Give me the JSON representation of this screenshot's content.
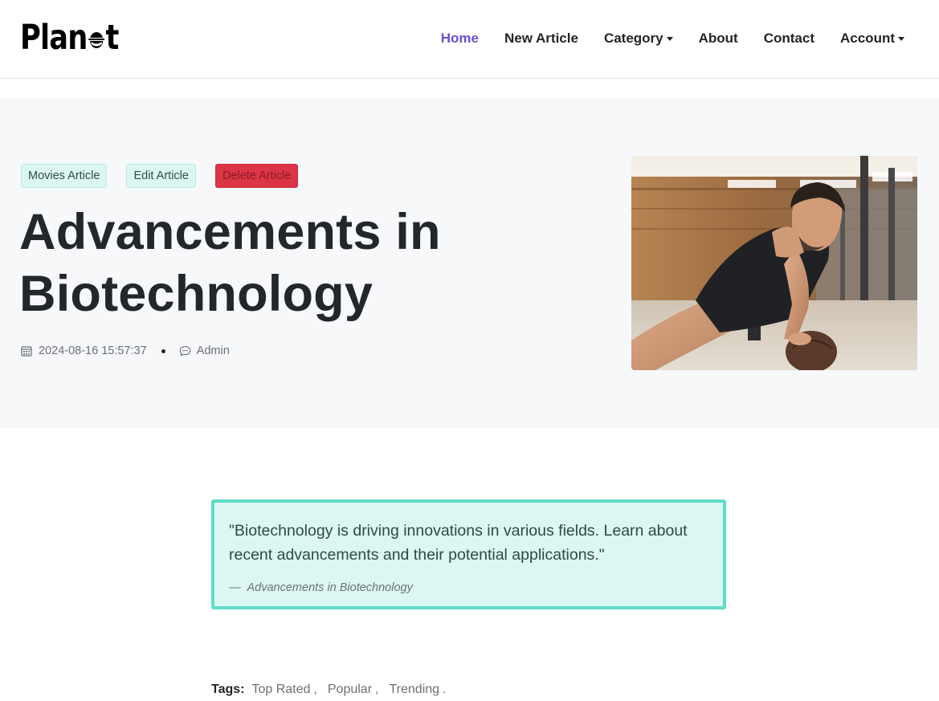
{
  "brand": {
    "text_before": "Plan",
    "text_after": "t"
  },
  "nav": {
    "home": "Home",
    "new_article": "New Article",
    "category": "Category",
    "about": "About",
    "contact": "Contact",
    "account": "Account"
  },
  "article": {
    "badges": {
      "category": "Movies Article",
      "edit": "Edit Article",
      "delete": "Delete Article"
    },
    "title": "Advancements in Biotechnology",
    "date": "2024-08-16 15:57:37",
    "author": "Admin"
  },
  "quote": {
    "text": "\"Biotechnology is driving innovations in various fields. Learn about recent advancements and their potential applications.\"",
    "dash": "—",
    "source": "Advancements in Biotechnology"
  },
  "tags": {
    "label": "Tags:",
    "items": [
      "Top Rated",
      "Popular",
      "Trending"
    ],
    "separator": ",",
    "end": "."
  },
  "colors": {
    "accent": "#6c4fd1",
    "mint_bg": "#dcf7f1",
    "mint_border": "#5edccb",
    "danger": "#dc3545"
  }
}
